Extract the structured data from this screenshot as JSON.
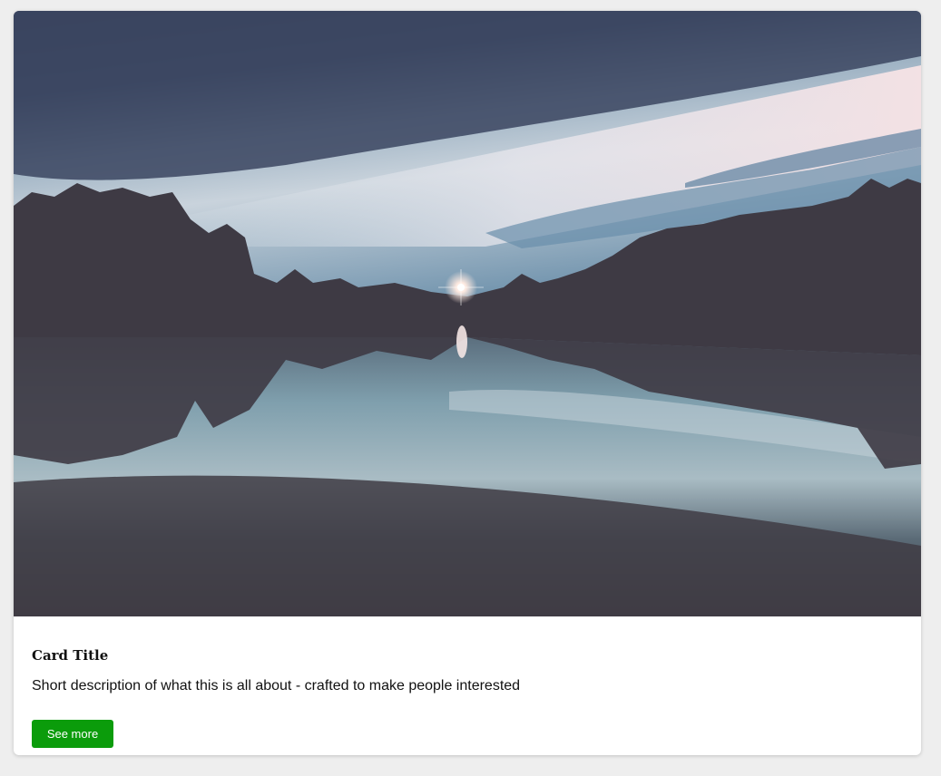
{
  "card": {
    "image": {
      "subject": "lake-at-dusk-landscape",
      "sky_top": "#3a4560",
      "sky_glow": "#f1dfe2",
      "horizon": "#6c94b0",
      "treeline": "#3e3a44",
      "water": "#6d8d9c",
      "foreground": "#403c44"
    },
    "title": "Card Title",
    "description": "Short description of what this is all about - crafted to make people interested",
    "button_label": "See more",
    "button_color": "#0b9c0b"
  }
}
